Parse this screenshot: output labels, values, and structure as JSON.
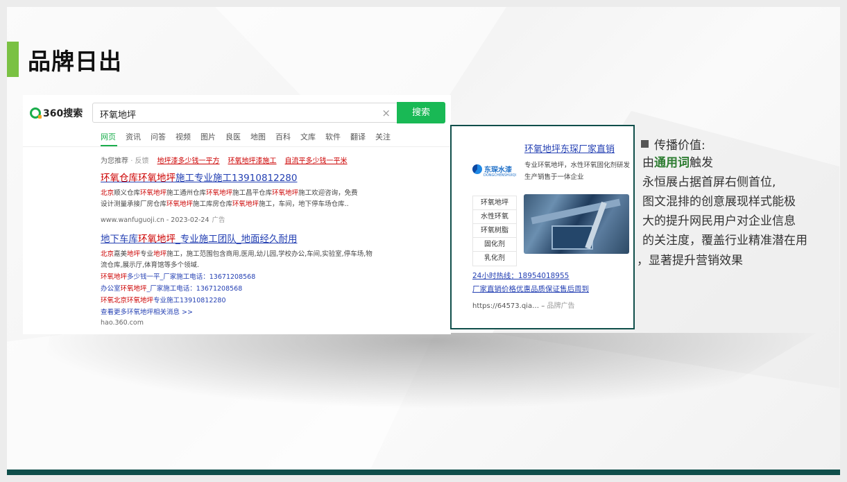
{
  "slide_title": "品牌日出",
  "serp": {
    "logo_text": "360搜索",
    "query": "环氧地坪",
    "search_button": "搜索",
    "tabs": [
      "网页",
      "资讯",
      "问答",
      "视频",
      "图片",
      "良医",
      "地图",
      "百科",
      "文库",
      "软件",
      "翻译",
      "关注"
    ],
    "suggest_label": "为您推荐",
    "feedback": "· 反馈",
    "suggestions": [
      "地坪漆多少钱一平方",
      "环氧地坪漆施工",
      "自流平多少钱一平米"
    ],
    "results": [
      {
        "title_parts": [
          "环氧仓库",
          "环氧地坪",
          "施工专业施工13910812280"
        ],
        "desc_line1_parts": [
          "北京",
          "顺义仓库",
          "环氧地坪",
          "施工通州仓库",
          "环氧地坪",
          "施工昌平仓库",
          "环氧地坪",
          "施工欢迎咨询，免费"
        ],
        "desc_line2_parts": [
          "设计测量承接厂房仓库",
          "环氧地坪",
          "施工库房仓库",
          "环氧地坪",
          "施工，车间，地下停车场仓库.."
        ],
        "url": "www.wanfuguoji.cn - 2023-02-24",
        "ad_label": "广告"
      },
      {
        "title_parts": [
          "地下车库",
          "环氧地坪",
          "_专业施工团队_地面经久耐用"
        ],
        "desc_line1_parts": [
          "北京",
          "嘉美",
          "地坪",
          "专业",
          "地坪",
          "施工，施工范围包含商用,医用,幼儿园,学校办公,车间,实验室,停车场,物"
        ],
        "desc_line2": "流仓库,展示厅,体育馆等多个领域.",
        "sublinks": [
          [
            "环氧地坪",
            "多少钱一平_厂家施工电话：13671208568"
          ],
          [
            "办公室",
            "环氧地坪",
            "_厂家施工电话：13671208568"
          ],
          [
            "环氧北京环氧地坪",
            "专业施工13910812280"
          ]
        ],
        "more": "查看更多环氧地坪相关消息 >>",
        "source": "hao.360.com"
      }
    ]
  },
  "ad": {
    "title": "环氧地坪东琛厂家直销",
    "brand_name": "东琛水漆",
    "brand_sub": "DONGCHENSHUIQI",
    "desc": "专业环氧地坪，水性环氧固化剂研发生产销售于一体企业",
    "list": [
      "环氧地坪",
      "水性环氧",
      "环氧树脂",
      "固化剂",
      "乳化剂"
    ],
    "hotline": "24小时热线：18954018955",
    "promo": "厂家直销价格优惠品质保证售后周到",
    "url": "https://64573.qia…",
    "url_sep": " – ",
    "ad_label": "品牌广告"
  },
  "value": {
    "heading": "传播价值:",
    "line1_prefix": "由",
    "keyword": "通用词",
    "line1_suffix": "触发",
    "lines": [
      "永恒展占据首屏右侧首位,",
      "图文混排的创意展现样式能极",
      "大的提升网民用户对企业信息",
      "的关注度，覆盖行业精准潜在用"
    ],
    "last_line": "，显著提升营销效果"
  },
  "colors": {
    "accent_green": "#7ac143",
    "brand_dark": "#0f4e4a",
    "search_green": "#19b955",
    "link_blue": "#2440b3",
    "highlight_red": "#cc0000",
    "keyword_green": "#2e7d32"
  }
}
